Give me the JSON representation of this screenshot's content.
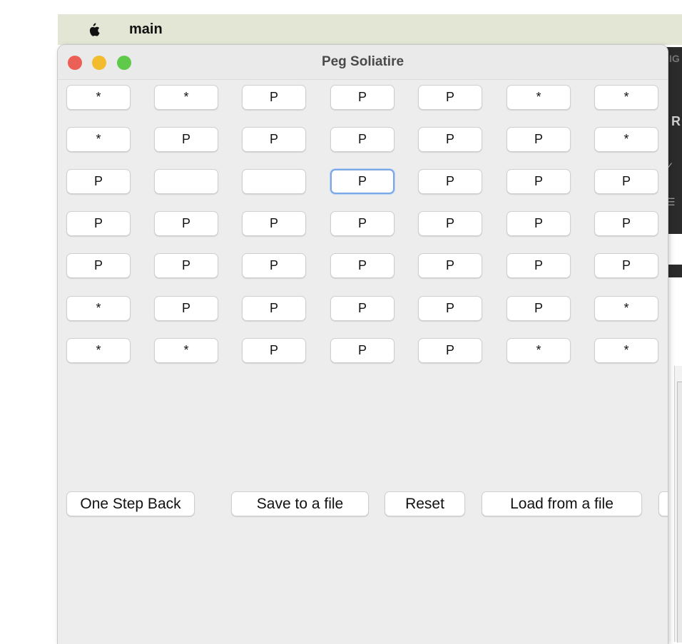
{
  "menubar": {
    "app_name": "main"
  },
  "window": {
    "title": "Peg Soliatire"
  },
  "board": {
    "rows": [
      [
        "*",
        "*",
        "P",
        "P",
        "P",
        "*",
        "*"
      ],
      [
        "*",
        "P",
        "P",
        "P",
        "P",
        "P",
        "*"
      ],
      [
        "P",
        "",
        "",
        "P",
        "P",
        "P",
        "P"
      ],
      [
        "P",
        "P",
        "P",
        "P",
        "P",
        "P",
        "P"
      ],
      [
        "P",
        "P",
        "P",
        "P",
        "P",
        "P",
        "P"
      ],
      [
        "*",
        "P",
        "P",
        "P",
        "P",
        "P",
        "*"
      ],
      [
        "*",
        "*",
        "P",
        "P",
        "P",
        "*",
        "*"
      ]
    ],
    "focused_cell": "row 3, column 4"
  },
  "buttons": {
    "back": "One Step Back",
    "save": "Save to a file",
    "reset": "Reset",
    "load": "Load from a file"
  },
  "background_app": {
    "text1": "IG",
    "text2": "R",
    "mark1": "✓",
    "mark2": "☰"
  },
  "colors": {
    "menubar": "#e3e6d5",
    "close": "#ec5f57",
    "minimize": "#f3bb2e",
    "maximize": "#5fc94a",
    "focus_ring": "#7aa7e6"
  }
}
